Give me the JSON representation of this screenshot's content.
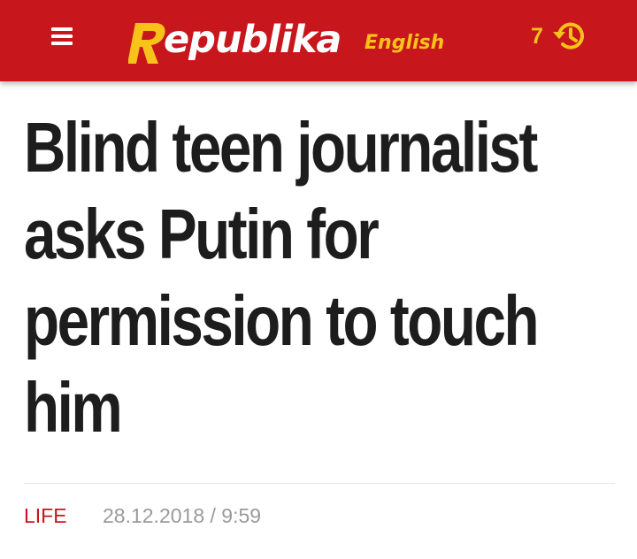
{
  "header": {
    "menu_icon": "hamburger-menu-icon",
    "logo": {
      "word": "epublika",
      "subtitle": "English",
      "mark_letter": "R"
    },
    "history": {
      "count": "7",
      "icon": "history-clock-icon"
    },
    "colors": {
      "bar": "#c8161d",
      "accent": "#f7c21a"
    }
  },
  "article": {
    "headline": "Blind teen journalist asks Putin for permission to touch him",
    "category": "LIFE",
    "datetime": "28.12.2018 / 9:59"
  }
}
